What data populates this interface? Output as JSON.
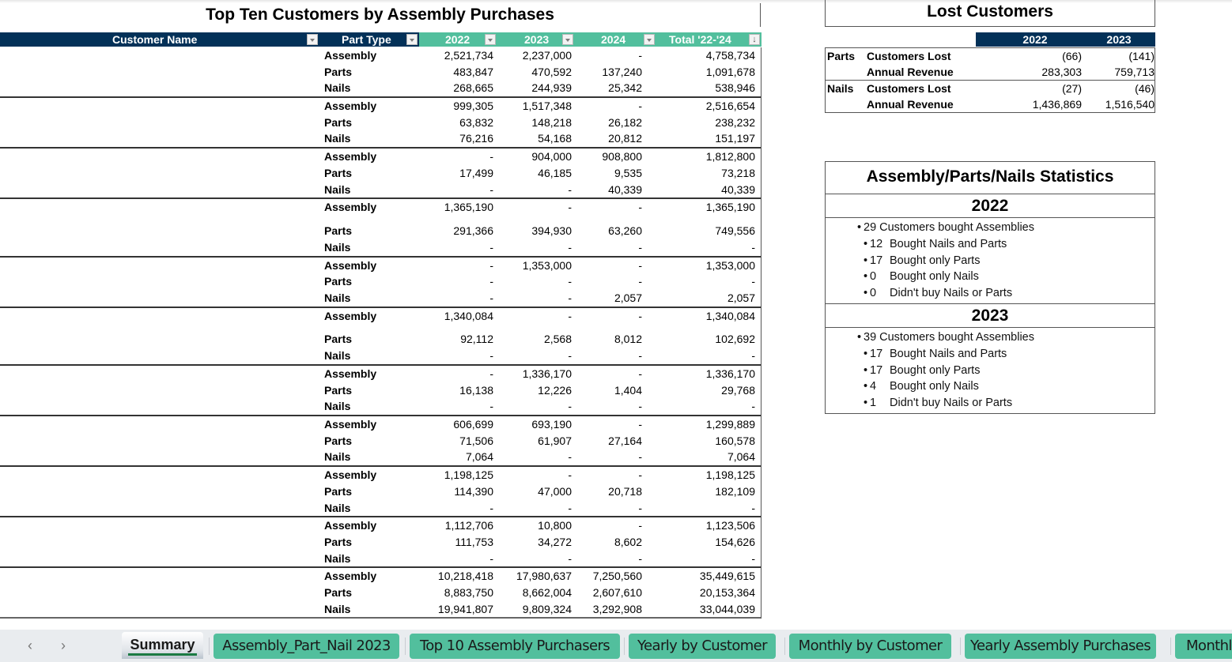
{
  "main_table": {
    "title": "Top Ten Customers by Assembly Purchases",
    "headers": {
      "customer_name": "Customer Name",
      "part_type": "Part Type",
      "y2022": "2022",
      "y2023": "2023",
      "y2024": "2024",
      "total": "Total '22-'24"
    },
    "sort_icon": "↓",
    "groups": [
      {
        "rows": [
          {
            "type": "Assembly",
            "y2022": "2,521,734",
            "y2023": "2,237,000",
            "y2024": "-",
            "total": "4,758,734"
          },
          {
            "type": "Parts",
            "y2022": "483,847",
            "y2023": "470,592",
            "y2024": "137,240",
            "total": "1,091,678"
          },
          {
            "type": "Nails",
            "y2022": "268,665",
            "y2023": "244,939",
            "y2024": "25,342",
            "total": "538,946"
          }
        ]
      },
      {
        "rows": [
          {
            "type": "Assembly",
            "y2022": "999,305",
            "y2023": "1,517,348",
            "y2024": "-",
            "total": "2,516,654"
          },
          {
            "type": "Parts",
            "y2022": "63,832",
            "y2023": "148,218",
            "y2024": "26,182",
            "total": "238,232"
          },
          {
            "type": "Nails",
            "y2022": "76,216",
            "y2023": "54,168",
            "y2024": "20,812",
            "total": "151,197"
          }
        ]
      },
      {
        "rows": [
          {
            "type": "Assembly",
            "y2022": "-",
            "y2023": "904,000",
            "y2024": "908,800",
            "total": "1,812,800"
          },
          {
            "type": "Parts",
            "y2022": "17,499",
            "y2023": "46,185",
            "y2024": "9,535",
            "total": "73,218"
          },
          {
            "type": "Nails",
            "y2022": "-",
            "y2023": "-",
            "y2024": "40,339",
            "total": "40,339"
          }
        ]
      },
      {
        "rows": [
          {
            "type": "Assembly",
            "y2022": "1,365,190",
            "y2023": "-",
            "y2024": "-",
            "total": "1,365,190"
          },
          {
            "type": "Parts",
            "y2022": "291,366",
            "y2023": "394,930",
            "y2024": "63,260",
            "total": "749,556"
          },
          {
            "type": "Nails",
            "y2022": "-",
            "y2023": "-",
            "y2024": "-",
            "total": "-"
          }
        ]
      },
      {
        "rows": [
          {
            "type": "Assembly",
            "y2022": "-",
            "y2023": "1,353,000",
            "y2024": "-",
            "total": "1,353,000"
          },
          {
            "type": "Parts",
            "y2022": "-",
            "y2023": "-",
            "y2024": "-",
            "total": "-"
          },
          {
            "type": "Nails",
            "y2022": "-",
            "y2023": "-",
            "y2024": "2,057",
            "total": "2,057"
          }
        ]
      },
      {
        "rows": [
          {
            "type": "Assembly",
            "y2022": "1,340,084",
            "y2023": "-",
            "y2024": "-",
            "total": "1,340,084"
          },
          {
            "type": "Parts",
            "y2022": "92,112",
            "y2023": "2,568",
            "y2024": "8,012",
            "total": "102,692"
          },
          {
            "type": "Nails",
            "y2022": "-",
            "y2023": "-",
            "y2024": "-",
            "total": "-"
          }
        ]
      },
      {
        "rows": [
          {
            "type": "Assembly",
            "y2022": "-",
            "y2023": "1,336,170",
            "y2024": "-",
            "total": "1,336,170"
          },
          {
            "type": "Parts",
            "y2022": "16,138",
            "y2023": "12,226",
            "y2024": "1,404",
            "total": "29,768"
          },
          {
            "type": "Nails",
            "y2022": "-",
            "y2023": "-",
            "y2024": "-",
            "total": "-"
          }
        ]
      },
      {
        "rows": [
          {
            "type": "Assembly",
            "y2022": "606,699",
            "y2023": "693,190",
            "y2024": "-",
            "total": "1,299,889"
          },
          {
            "type": "Parts",
            "y2022": "71,506",
            "y2023": "61,907",
            "y2024": "27,164",
            "total": "160,578"
          },
          {
            "type": "Nails",
            "y2022": "7,064",
            "y2023": "-",
            "y2024": "-",
            "total": "7,064"
          }
        ]
      },
      {
        "rows": [
          {
            "type": "Assembly",
            "y2022": "1,198,125",
            "y2023": "-",
            "y2024": "-",
            "total": "1,198,125"
          },
          {
            "type": "Parts",
            "y2022": "114,390",
            "y2023": "47,000",
            "y2024": "20,718",
            "total": "182,109"
          },
          {
            "type": "Nails",
            "y2022": "-",
            "y2023": "-",
            "y2024": "-",
            "total": "-"
          }
        ]
      },
      {
        "rows": [
          {
            "type": "Assembly",
            "y2022": "1,112,706",
            "y2023": "10,800",
            "y2024": "-",
            "total": "1,123,506"
          },
          {
            "type": "Parts",
            "y2022": "111,753",
            "y2023": "34,272",
            "y2024": "8,602",
            "total": "154,626"
          },
          {
            "type": "Nails",
            "y2022": "-",
            "y2023": "-",
            "y2024": "-",
            "total": "-"
          }
        ]
      },
      {
        "rows": [
          {
            "type": "Assembly",
            "y2022": "10,218,418",
            "y2023": "17,980,637",
            "y2024": "7,250,560",
            "total": "35,449,615"
          },
          {
            "type": "Parts",
            "y2022": "8,883,750",
            "y2023": "8,662,004",
            "y2024": "2,607,610",
            "total": "20,153,364"
          },
          {
            "type": "Nails",
            "y2022": "19,941,807",
            "y2023": "9,809,324",
            "y2024": "3,292,908",
            "total": "33,044,039"
          }
        ]
      }
    ]
  },
  "lost_customers": {
    "title": "Lost Customers",
    "years": [
      "2022",
      "2023"
    ],
    "groups": [
      {
        "category": "Parts",
        "rows": [
          {
            "metric": "Customers Lost",
            "y2022": "(66)",
            "y2023": "(141)"
          },
          {
            "metric": "Annual Revenue",
            "y2022": "283,303",
            "y2023": "759,713"
          }
        ]
      },
      {
        "category": "Nails",
        "rows": [
          {
            "metric": "Customers Lost",
            "y2022": "(27)",
            "y2023": "(46)"
          },
          {
            "metric": "Annual Revenue",
            "y2022": "1,436,869",
            "y2023": "1,516,540"
          }
        ]
      }
    ]
  },
  "statistics": {
    "title": "Assembly/Parts/Nails Statistics",
    "years": [
      {
        "year": "2022",
        "main": {
          "count": "29",
          "text": "Customers bought Assemblies"
        },
        "items": [
          {
            "count": "12",
            "text": "Bought Nails and Parts"
          },
          {
            "count": "17",
            "text": "Bought only Parts"
          },
          {
            "count": "0",
            "text": "Bought only Nails"
          },
          {
            "count": "0",
            "text": "Didn't buy Nails or Parts"
          }
        ]
      },
      {
        "year": "2023",
        "main": {
          "count": "39",
          "text": "Customers bought Assemblies"
        },
        "items": [
          {
            "count": "17",
            "text": "Bought Nails and Parts"
          },
          {
            "count": "17",
            "text": "Bought only Parts"
          },
          {
            "count": "4",
            "text": "Bought only Nails"
          },
          {
            "count": "1",
            "text": "Didn't buy Nails or Parts"
          }
        ]
      }
    ]
  },
  "sheet_tabs": {
    "prev_icon": "‹",
    "next_icon": "›",
    "active": "Summary",
    "tabs": [
      "Summary",
      "Assembly_Part_Nail 2023",
      "Top 10 Assembly Purchasers",
      "Yearly by Customer",
      "Monthly by Customer",
      "Yearly Assembly Purchases",
      "Monthly Assembly Purchases"
    ]
  },
  "colors": {
    "header_navy": "#033158",
    "header_green": "#52bf9d",
    "tab_green": "#52bf9d"
  }
}
